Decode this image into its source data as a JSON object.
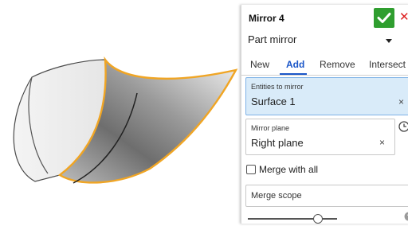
{
  "feature": {
    "title": "Mirror 4",
    "ok_icon": "check-icon",
    "close_icon": "close-icon",
    "close_glyph": "✕"
  },
  "mirror_type": {
    "value": "Part mirror"
  },
  "tabs": [
    {
      "label": "New"
    },
    {
      "label": "Add"
    },
    {
      "label": "Remove"
    },
    {
      "label": "Intersect"
    }
  ],
  "entities_field": {
    "label": "Entities to mirror",
    "value": "Surface 1",
    "clear": "×"
  },
  "plane_field": {
    "label": "Mirror plane",
    "value": "Right plane",
    "clear": "×"
  },
  "merge_all": {
    "label": "Merge with all",
    "checked": false
  },
  "merge_scope": {
    "label": "Merge scope"
  },
  "slider": {
    "value_fraction": 0.78
  },
  "colors": {
    "accent": "#1a56c8",
    "ok_green": "#2f9e2f",
    "selection_orange": "#f0a524",
    "selected_field_bg": "#d9ebf9"
  }
}
